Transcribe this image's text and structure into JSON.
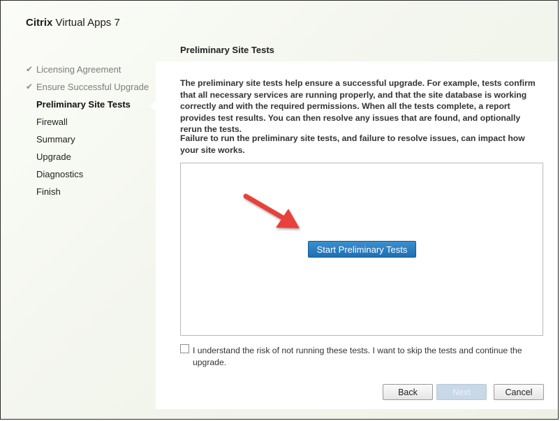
{
  "app": {
    "brand": "Citrix",
    "product": "Virtual Apps 7"
  },
  "sidebar": {
    "steps": [
      {
        "label": "Licensing Agreement",
        "state": "done"
      },
      {
        "label": "Ensure Successful Upgrade",
        "state": "done"
      },
      {
        "label": "Preliminary Site Tests",
        "state": "current"
      },
      {
        "label": "Firewall",
        "state": "pending"
      },
      {
        "label": "Summary",
        "state": "pending"
      },
      {
        "label": "Upgrade",
        "state": "pending"
      },
      {
        "label": "Diagnostics",
        "state": "pending"
      },
      {
        "label": "Finish",
        "state": "pending"
      }
    ],
    "check_icon": "✔"
  },
  "main": {
    "title": "Preliminary Site Tests",
    "paragraph1": "The preliminary site tests help ensure a successful upgrade. For example, tests confirm that all necessary services are running properly, and that the site database is working correctly and with the required permissions. When all the tests complete, a report provides test results. You can then resolve any issues that are found, and optionally rerun the tests.",
    "paragraph2": "Failure to run the preliminary site tests, and failure to resolve issues, can impact how your site works.",
    "start_button": "Start Preliminary Tests",
    "skip_checkbox_label": "I understand the risk of not running these tests. I want to skip the tests and continue the upgrade.",
    "skip_checked": false
  },
  "footer": {
    "back": "Back",
    "next": "Next",
    "cancel": "Cancel"
  },
  "colors": {
    "accent_button": "#2a7fc1",
    "arrow": "#e8403a"
  }
}
